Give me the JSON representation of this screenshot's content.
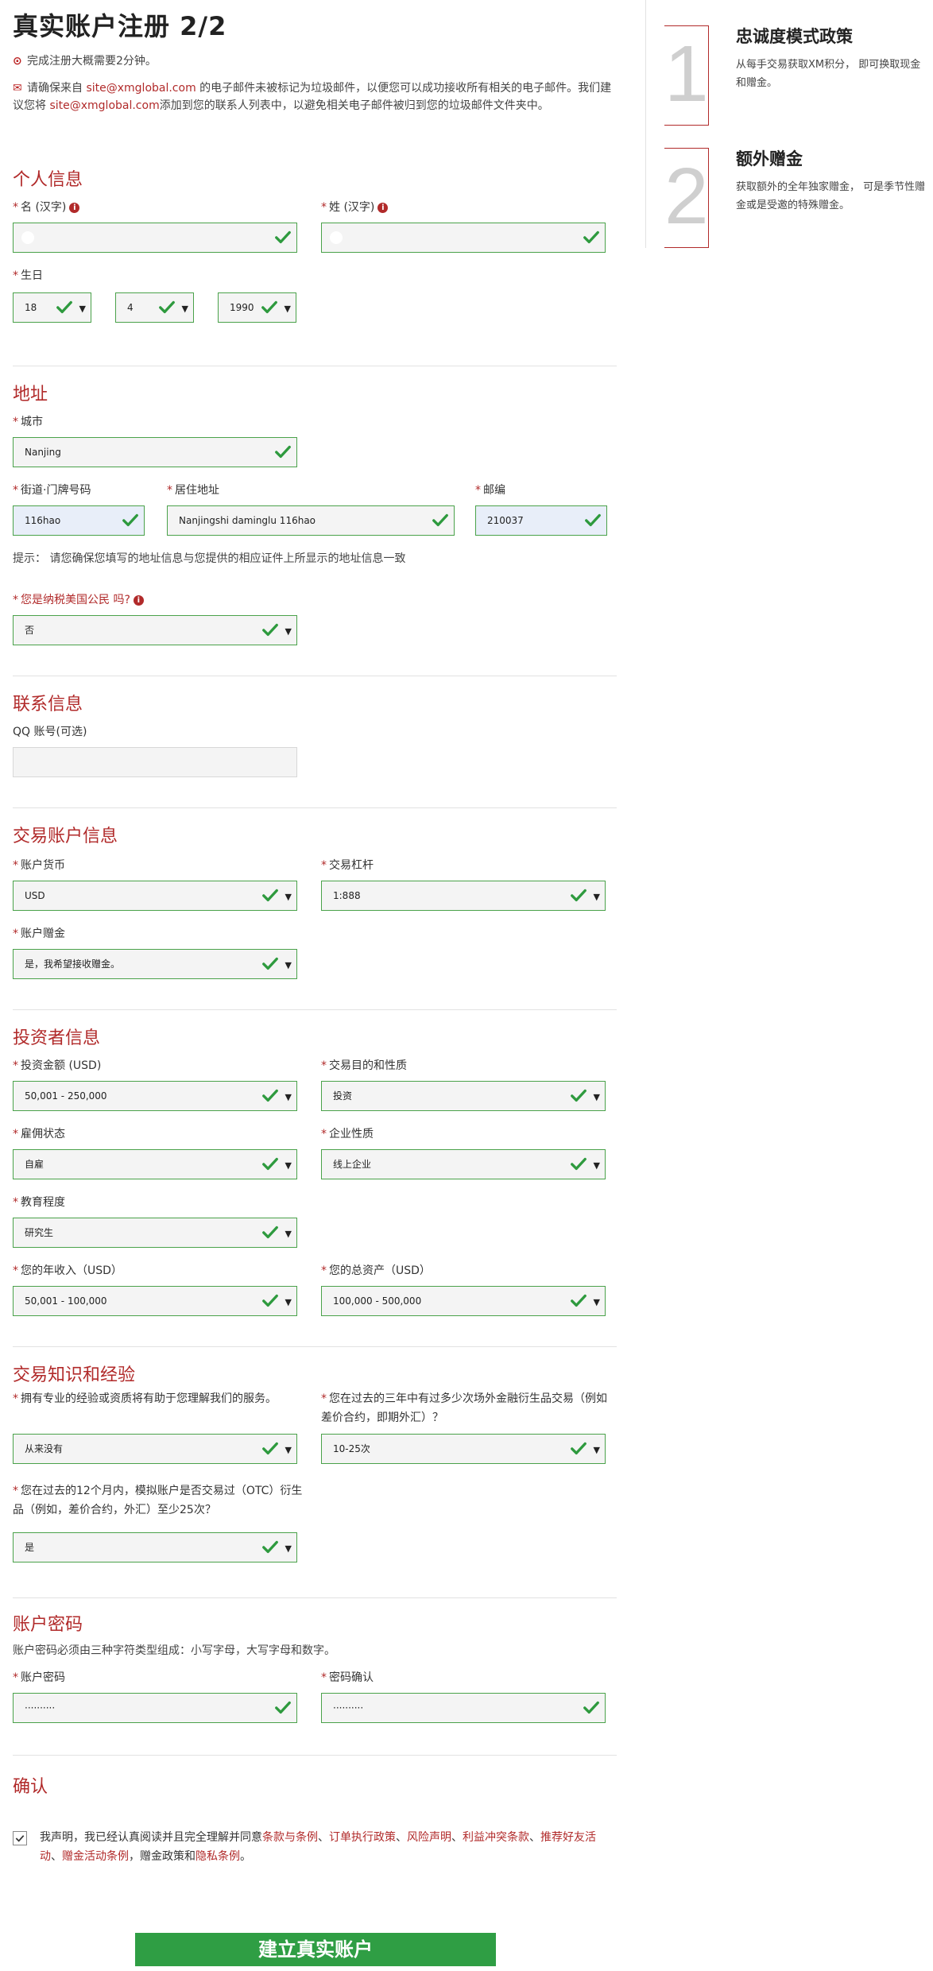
{
  "header": {
    "title": "真实账户注册 2/2",
    "notice_time": "完成注册大概需要2分钟。",
    "notice_email_pre": "请确保来自 ",
    "notice_email_link1": "site@xmglobal.com",
    "notice_email_mid": " 的电子邮件未被标记为垃圾邮件，以便您可以成功接收所有相关的电子邮件。我们建议您将 ",
    "notice_email_link2": "site@xmglobal.com",
    "notice_email_post": "添加到您的联系人列表中，以避免相关电子邮件被归到您的垃圾邮件文件夹中。"
  },
  "personal": {
    "title": "个人信息",
    "first_name_label": "名 (汉字)",
    "last_name_label": "姓 (汉字)",
    "birthday_label": "生日",
    "day": "18",
    "month": "4",
    "year": "1990"
  },
  "address": {
    "title": "地址",
    "city_label": "城市",
    "city": "Nanjing",
    "street_label": "街道·门牌号码",
    "street": "116hao",
    "residence_label": "居住地址",
    "residence": "Nanjingshi daminglu 116hao",
    "postcode_label": "邮编",
    "postcode": "210037",
    "hint": "提示： 请您确保您填写的地址信息与您提供的相应证件上所显示的地址信息一致",
    "us_tax_label": "您是纳税美国公民 吗?",
    "us_tax": "否"
  },
  "contact": {
    "title": "联系信息",
    "qq_label": "QQ 账号(可选)"
  },
  "trading_account": {
    "title": "交易账户信息",
    "currency_label": "账户货币",
    "currency": "USD",
    "leverage_label": "交易杠杆",
    "leverage": "1:888",
    "bonus_label": "账户赠金",
    "bonus": "是，我希望接收赠金。"
  },
  "investor": {
    "title": "投资者信息",
    "amount_label": "投资金额 (USD)",
    "amount": "50,001 - 250,000",
    "purpose_label": "交易目的和性质",
    "purpose": "投资",
    "employment_label": "雇佣状态",
    "employment": "自雇",
    "business_label": "企业性质",
    "business": "线上企业",
    "education_label": "教育程度",
    "education": "研究生",
    "income_label": "您的年收入（USD）",
    "income": "50,001 - 100,000",
    "assets_label": "您的总资产（USD）",
    "assets": "100,000 - 500,000"
  },
  "knowledge": {
    "title": "交易知识和经验",
    "q1_label": "拥有专业的经验或资质将有助于您理解我们的服务。",
    "q1": "从来没有",
    "q2_label": "您在过去的三年中有过多少次场外金融衍生品交易（例如差价合约，即期外汇）？",
    "q2": "10-25次",
    "q3_label": "您在过去的12个月内，模拟账户是否交易过（OTC）衍生品（例如，差价合约，外汇）至少25次？",
    "q3": "是"
  },
  "password": {
    "title": "账户密码",
    "rule": "账户密码必须由三种字符类型组成：小写字母，大写字母和数字。",
    "password_label": "账户密码",
    "password_value": "··········",
    "confirm_label": "密码确认",
    "confirm_value": "··········"
  },
  "confirm": {
    "title": "确认",
    "t1": "我声明，我已经认真阅读并且完全理解并同意",
    "l1": "条款与条例",
    "s1": "、",
    "l2": "订单执行政策",
    "s2": "、",
    "l3": "风险声明",
    "s3": "、",
    "l4": "利益冲突条款",
    "s4": "、",
    "l5": "推荐好友活动",
    "s5": "、",
    "l6": "赠金活动条例",
    "t2": "，赠金政策和",
    "l7": "隐私条例",
    "t3": "。"
  },
  "submit_label": "建立真实账户",
  "sidebar": {
    "steps": [
      {
        "num": "1",
        "title": "忠诚度模式政策",
        "desc": "从每手交易获取XM积分， 即可换取现金和赠金。"
      },
      {
        "num": "2",
        "title": "额外赠金",
        "desc": "获取额外的全年独家赠金， 可是季节性赠金或是受邀的特殊赠金。"
      }
    ]
  },
  "colors": {
    "accent": "#b12a2a",
    "valid_border": "#4aa24a",
    "submit": "#2f9e44"
  }
}
